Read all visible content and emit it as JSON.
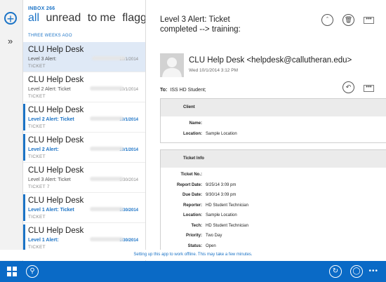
{
  "nav": {
    "compose_glyph": "+",
    "expand_glyph": "»"
  },
  "list": {
    "inbox_label": "INBOX 266",
    "filters": [
      "all",
      "unread",
      "to me",
      "flagged"
    ],
    "group_label": "THREE WEEKS AGO",
    "items": [
      {
        "sender": "CLU Help Desk",
        "subject": "Level 3 Alert:",
        "tag": "TICKET",
        "date": "10/1/2014",
        "unread": false,
        "selected": true
      },
      {
        "sender": "CLU Help Desk",
        "subject": "Level 2 Alert: Ticket",
        "tag": "TICKET",
        "date": "10/1/2014",
        "unread": false,
        "selected": false
      },
      {
        "sender": "CLU Help Desk",
        "subject": "Level 2 Alert: Ticket",
        "tag": "TICKET",
        "date": "10/1/2014",
        "unread": true,
        "selected": false
      },
      {
        "sender": "CLU Help Desk",
        "subject": "Level 2 Alert:",
        "tag": "TICKET",
        "date": "10/1/2014",
        "unread": true,
        "selected": false
      },
      {
        "sender": "CLU Help Desk",
        "subject": "Level 3 Alert: Ticket",
        "tag": "TICKET 7",
        "date": "9/30/2014",
        "unread": false,
        "selected": false
      },
      {
        "sender": "CLU Help Desk",
        "subject": "Level 1 Alert: Ticket",
        "tag": "TICKET",
        "date": "9/30/2014",
        "unread": true,
        "selected": false
      },
      {
        "sender": "CLU Help Desk",
        "subject": "Level 1 Alert:",
        "tag": "TICKET",
        "date": "9/30/2014",
        "unread": true,
        "selected": false
      }
    ]
  },
  "message": {
    "subject": "Level 3 Alert: Ticket completed --> training:",
    "from": "CLU Help Desk <helpdesk@callutheran.edu>",
    "sent": "Wed 10/1/2014 3:12 PM",
    "to_label": "To:",
    "to_value": "ISS HD Student;",
    "more_glyph": "•••",
    "sections": [
      {
        "title": "Client",
        "fields": [
          {
            "label": "Name:",
            "value": ""
          },
          {
            "label": "Location:",
            "value": "Sample Location"
          }
        ]
      },
      {
        "title": "Ticket Info",
        "fields": [
          {
            "label": "Ticket No.:",
            "value": ""
          },
          {
            "label": "Report Date:",
            "value": "9/25/14 3:09 pm"
          },
          {
            "label": "Due Date:",
            "value": "9/30/14 3:09 pm"
          },
          {
            "label": "Reporter:",
            "value": "HD Student Technician"
          },
          {
            "label": "Location:",
            "value": "Sample Location"
          },
          {
            "label": "Tech:",
            "value": "HD Student Technician"
          },
          {
            "label": "Priority:",
            "value": "Two Day"
          },
          {
            "label": "Status:",
            "value": "Open"
          }
        ]
      }
    ]
  },
  "notice": "Setting up this app to work offline. This may take a few minutes.",
  "taskbar": {
    "more_glyph": "•••"
  },
  "colors": {
    "accent": "#1b73c6",
    "taskbar": "#0a6ac6",
    "selected": "#dfe9f6"
  }
}
